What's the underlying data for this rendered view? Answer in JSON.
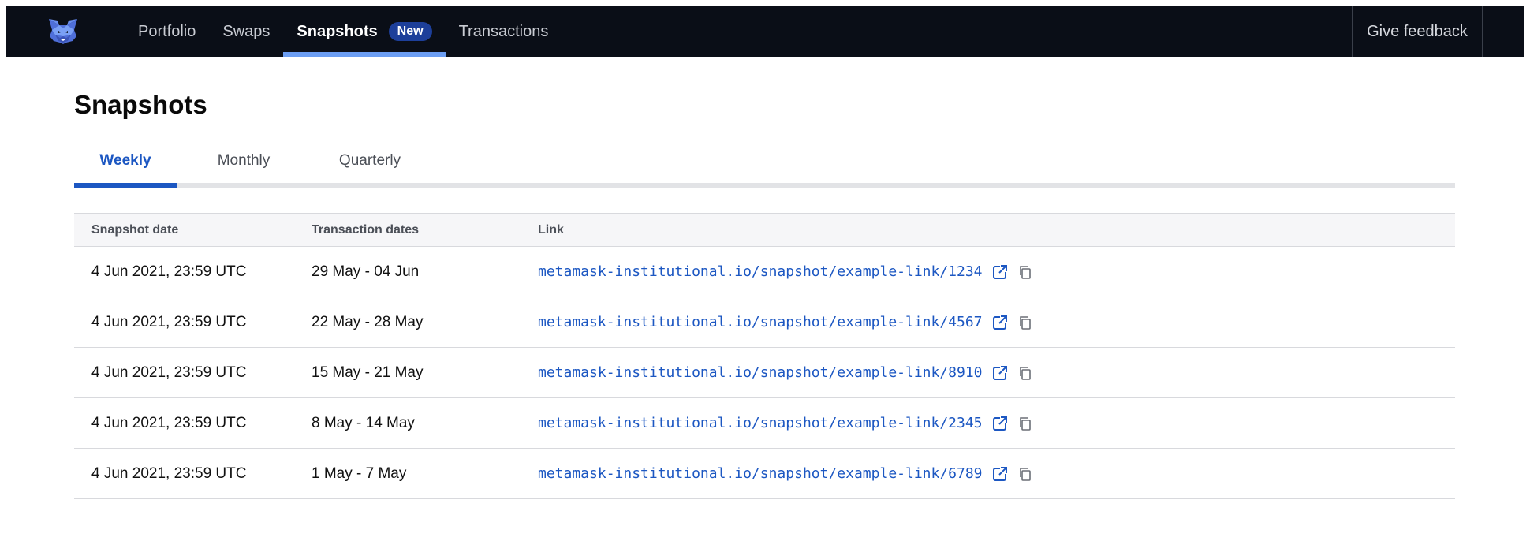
{
  "nav": {
    "items": [
      {
        "label": "Portfolio"
      },
      {
        "label": "Swaps"
      },
      {
        "label": "Snapshots",
        "badge": "New"
      },
      {
        "label": "Transactions"
      }
    ],
    "active": "Snapshots",
    "feedback_label": "Give feedback"
  },
  "page": {
    "title": "Snapshots"
  },
  "tabs": [
    {
      "label": "Weekly"
    },
    {
      "label": "Monthly"
    },
    {
      "label": "Quarterly"
    }
  ],
  "active_tab": "Weekly",
  "table": {
    "headers": [
      "Snapshot date",
      "Transaction dates",
      "Link"
    ],
    "rows": [
      {
        "snapshot_date": "4 Jun 2021, 23:59 UTC",
        "transaction_dates": "29 May - 04 Jun",
        "link": "metamask-institutional.io/snapshot/example-link/1234"
      },
      {
        "snapshot_date": "4 Jun 2021, 23:59 UTC",
        "transaction_dates": "22 May - 28 May",
        "link": "metamask-institutional.io/snapshot/example-link/4567"
      },
      {
        "snapshot_date": "4 Jun 2021, 23:59 UTC",
        "transaction_dates": "15 May - 21 May",
        "link": "metamask-institutional.io/snapshot/example-link/8910"
      },
      {
        "snapshot_date": "4 Jun 2021, 23:59 UTC",
        "transaction_dates": "8 May - 14 May",
        "link": "metamask-institutional.io/snapshot/example-link/2345"
      },
      {
        "snapshot_date": "4 Jun 2021, 23:59 UTC",
        "transaction_dates": "1 May - 7 May",
        "link": "metamask-institutional.io/snapshot/example-link/6789"
      }
    ]
  },
  "icons": {
    "logo": "metamask-fox-icon",
    "open": "external-link-icon",
    "copy": "copy-icon"
  },
  "colors": {
    "topbar": "#0a0e17",
    "accent": "#1c57c2",
    "nav_active_underline": "#6c9ef3",
    "badge": "#1d3f9a"
  }
}
